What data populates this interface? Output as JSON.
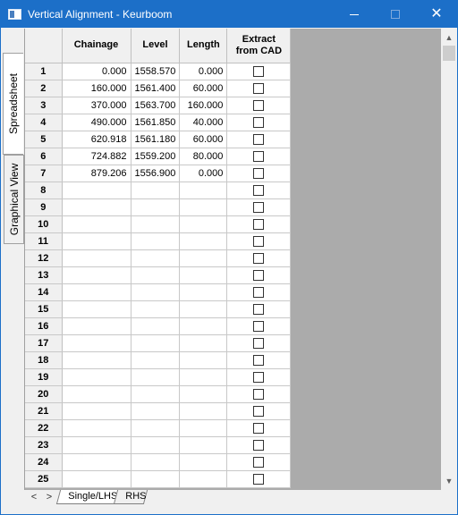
{
  "window": {
    "title": "Vertical Alignment - Keurboom"
  },
  "titlebar_buttons": {
    "minimize": "—",
    "maximize": "",
    "close": "✕"
  },
  "side_tabs": [
    "Spreadsheet",
    "Graphical View"
  ],
  "grid": {
    "columns": [
      "Chainage",
      "Level",
      "Length",
      "Extract from CAD"
    ],
    "rows": [
      {
        "n": "1",
        "chainage": "0.000",
        "level": "1558.570",
        "length": "0.000"
      },
      {
        "n": "2",
        "chainage": "160.000",
        "level": "1561.400",
        "length": "60.000"
      },
      {
        "n": "3",
        "chainage": "370.000",
        "level": "1563.700",
        "length": "160.000"
      },
      {
        "n": "4",
        "chainage": "490.000",
        "level": "1561.850",
        "length": "40.000"
      },
      {
        "n": "5",
        "chainage": "620.918",
        "level": "1561.180",
        "length": "60.000"
      },
      {
        "n": "6",
        "chainage": "724.882",
        "level": "1559.200",
        "length": "80.000"
      },
      {
        "n": "7",
        "chainage": "879.206",
        "level": "1556.900",
        "length": "0.000"
      },
      {
        "n": "8",
        "chainage": "",
        "level": "",
        "length": ""
      },
      {
        "n": "9",
        "chainage": "",
        "level": "",
        "length": ""
      },
      {
        "n": "10",
        "chainage": "",
        "level": "",
        "length": ""
      },
      {
        "n": "11",
        "chainage": "",
        "level": "",
        "length": ""
      },
      {
        "n": "12",
        "chainage": "",
        "level": "",
        "length": ""
      },
      {
        "n": "13",
        "chainage": "",
        "level": "",
        "length": ""
      },
      {
        "n": "14",
        "chainage": "",
        "level": "",
        "length": ""
      },
      {
        "n": "15",
        "chainage": "",
        "level": "",
        "length": ""
      },
      {
        "n": "16",
        "chainage": "",
        "level": "",
        "length": ""
      },
      {
        "n": "17",
        "chainage": "",
        "level": "",
        "length": ""
      },
      {
        "n": "18",
        "chainage": "",
        "level": "",
        "length": ""
      },
      {
        "n": "19",
        "chainage": "",
        "level": "",
        "length": ""
      },
      {
        "n": "20",
        "chainage": "",
        "level": "",
        "length": ""
      },
      {
        "n": "21",
        "chainage": "",
        "level": "",
        "length": ""
      },
      {
        "n": "22",
        "chainage": "",
        "level": "",
        "length": ""
      },
      {
        "n": "23",
        "chainage": "",
        "level": "",
        "length": ""
      },
      {
        "n": "24",
        "chainage": "",
        "level": "",
        "length": ""
      },
      {
        "n": "25",
        "chainage": "",
        "level": "",
        "length": ""
      }
    ]
  },
  "sheet_tabs": [
    "Single/LHS",
    "RHS"
  ],
  "nav": {
    "prev": "<",
    "next": ">"
  },
  "scroll": {
    "up": "▲",
    "down": "▼"
  }
}
